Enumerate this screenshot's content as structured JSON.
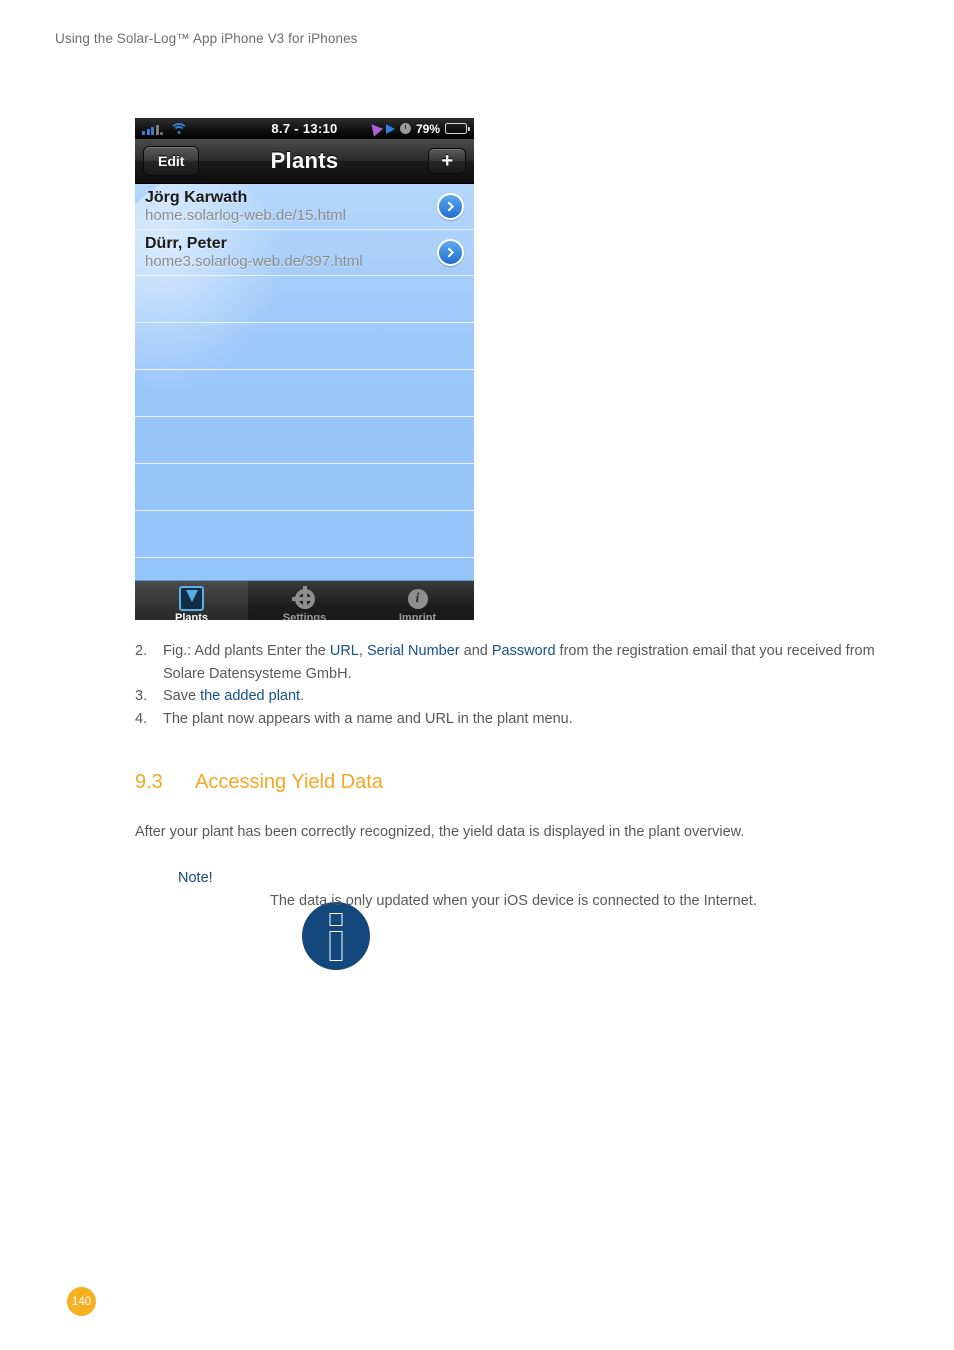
{
  "document": {
    "running_header": "Using the Solar-Log™ App iPhone V3 for iPhones",
    "page_number": "140"
  },
  "phone": {
    "status_bar": {
      "carrier_signal_icon": "signal-bars-icon",
      "wifi_icon": "wifi-icon",
      "time": "8.7 - 13:10",
      "location_icon": "location-arrow-icon",
      "play_icon": "play-icon",
      "alarm_icon": "alarm-clock-icon",
      "battery_percent": "79%",
      "battery_icon": "battery-icon"
    },
    "nav_bar": {
      "edit_label": "Edit",
      "title": "Plants",
      "add_label": "+"
    },
    "list": {
      "rows": [
        {
          "name": "Jörg Karwath",
          "url": "home.solarlog-web.de/15.html"
        },
        {
          "name": "Dürr, Peter",
          "url": "home3.solarlog-web.de/397.html"
        }
      ],
      "empty_row_count": 7
    },
    "tab_bar": {
      "items": [
        {
          "label": "Plants",
          "icon": "plants-icon",
          "active": true
        },
        {
          "label": "Settings",
          "icon": "gear-icon",
          "active": false
        },
        {
          "label": "Imprint",
          "icon": "info-icon",
          "active": false
        }
      ]
    }
  },
  "steps": [
    {
      "num": "2.",
      "parts": [
        {
          "text": "Fig.: Add plants Enter the ",
          "link": false
        },
        {
          "text": "URL",
          "link": true
        },
        {
          "text": ", ",
          "link": false
        },
        {
          "text": "Serial Number",
          "link": true
        },
        {
          "text": " and ",
          "link": false
        },
        {
          "text": "Password",
          "link": true
        },
        {
          "text": " from the registration email that you received from Solare Datensysteme GmbH.",
          "link": false
        }
      ]
    },
    {
      "num": "3.",
      "parts": [
        {
          "text": "Save ",
          "link": false
        },
        {
          "text": "the added plant",
          "link": true
        },
        {
          "text": ".",
          "link": false
        }
      ]
    },
    {
      "num": "4.",
      "parts": [
        {
          "text": "The plant now appears with a name and URL in the plant menu.",
          "link": false
        }
      ]
    }
  ],
  "section": {
    "number": "9.3",
    "title": "Accessing Yield Data",
    "intro": "After your plant has been correctly recognized, the yield data is displayed in the plant overview."
  },
  "note": {
    "label": "Note!",
    "icon": "info-circle-icon",
    "text": "The data is only updated when your iOS device is connected to the Internet."
  },
  "colors": {
    "accent_orange": "#f5a623",
    "link_blue": "#15528d",
    "note_blue": "#14477c",
    "body_gray": "#58585a"
  }
}
